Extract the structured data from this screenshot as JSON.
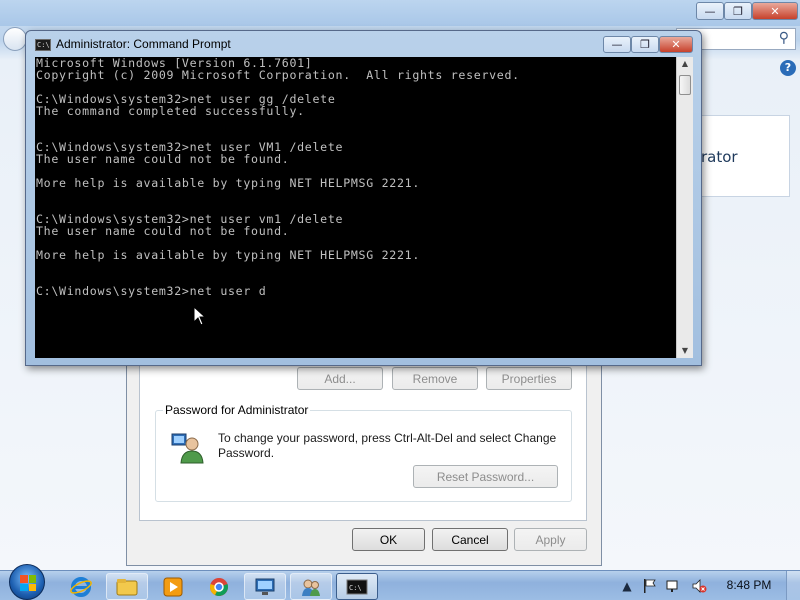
{
  "background_window": {
    "right_pane_text": "rator",
    "search_icon": "search-icon",
    "help_icon": "?"
  },
  "cmd": {
    "title": "Administrator: Command Prompt",
    "lines": [
      "Microsoft Windows [Version 6.1.7601]",
      "Copyright (c) 2009 Microsoft Corporation.  All rights reserved.",
      "",
      "C:\\Windows\\system32>net user gg /delete",
      "The command completed successfully.",
      "",
      "",
      "C:\\Windows\\system32>net user VM1 /delete",
      "The user name could not be found.",
      "",
      "More help is available by typing NET HELPMSG 2221.",
      "",
      "",
      "C:\\Windows\\system32>net user vm1 /delete",
      "The user name could not be found.",
      "",
      "More help is available by typing NET HELPMSG 2221.",
      "",
      "",
      "C:\\Windows\\system32>net user d"
    ]
  },
  "dialog": {
    "add_label": "Add...",
    "remove_label": "Remove",
    "properties_label": "Properties",
    "password_group_label": "Password for Administrator",
    "password_text": "To change your password, press Ctrl-Alt-Del and select Change Password.",
    "reset_password_label": "Reset Password...",
    "ok_label": "OK",
    "cancel_label": "Cancel",
    "apply_label": "Apply"
  },
  "taskbar": {
    "clock": "8:48 PM",
    "items": [
      "internet-explorer-icon",
      "windows-explorer-icon",
      "media-player-icon",
      "chrome-icon",
      "remote-desktop-icon",
      "user-accounts-icon",
      "command-prompt-icon"
    ]
  }
}
